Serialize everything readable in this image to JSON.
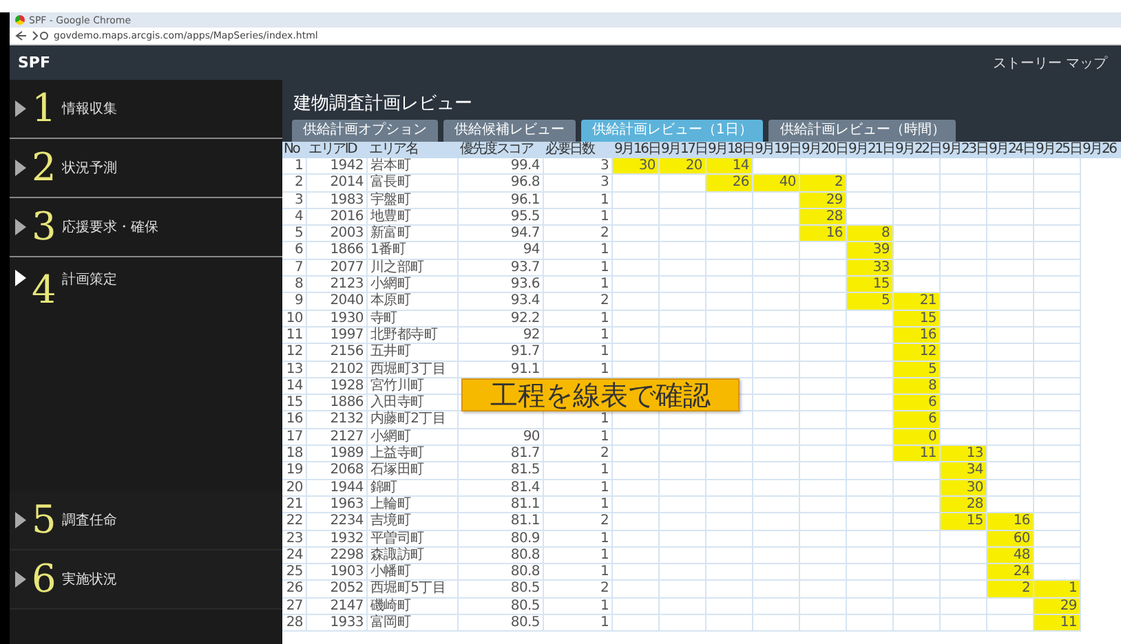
{
  "browser": {
    "title": "SPF - Google Chrome",
    "url": "govdemo.maps.arcgis.com/apps/MapSeries/index.html"
  },
  "header": {
    "app_name": "SPF",
    "link": "ストーリー マップ"
  },
  "sidebar": {
    "items": [
      {
        "number": "1",
        "label": "情報収集",
        "selected": false
      },
      {
        "number": "2",
        "label": "状況予測",
        "selected": false
      },
      {
        "number": "3",
        "label": "応援要求・確保",
        "selected": false
      },
      {
        "number": "4",
        "label": "計画策定",
        "selected": true
      },
      {
        "number": "5",
        "label": "調査任命",
        "selected": false
      },
      {
        "number": "6",
        "label": "実施状況",
        "selected": false
      }
    ]
  },
  "page_title": "建物調査計画レビュー",
  "tabs": [
    {
      "label": "供給計画オプション",
      "selected": false
    },
    {
      "label": "供給候補レビュー",
      "selected": false
    },
    {
      "label": "供給計画レビュー（1日）",
      "selected": true
    },
    {
      "label": "供給計画レビュー（時間）",
      "selected": false
    }
  ],
  "table": {
    "columns": [
      "No",
      "エリアID",
      "エリア名",
      "優先度スコア",
      "必要日数",
      "9月16日",
      "9月17日",
      "9月18日",
      "9月19日",
      "9月20日",
      "9月21日",
      "9月22日",
      "9月23日",
      "9月24日",
      "9月25日",
      "9月26"
    ],
    "rows": [
      {
        "cells": [
          "1",
          "1942",
          "岩本町",
          "99.4",
          "3",
          {
            "value": "30",
            "scheduled": true
          },
          {
            "value": "20",
            "scheduled": true
          },
          {
            "value": "14",
            "scheduled": true
          },
          {
            "scheduled": false
          },
          {
            "scheduled": false
          },
          {
            "scheduled": false
          },
          {
            "scheduled": false
          },
          {
            "scheduled": false
          },
          {
            "scheduled": false
          },
          {
            "scheduled": false
          }
        ]
      },
      {
        "cells": [
          "2",
          "2014",
          "富長町",
          "96.8",
          "3",
          {
            "scheduled": false
          },
          {
            "scheduled": false
          },
          {
            "value": "26",
            "scheduled": true
          },
          {
            "value": "40",
            "scheduled": true
          },
          {
            "value": "2",
            "scheduled": true
          },
          {
            "scheduled": false
          },
          {
            "scheduled": false
          },
          {
            "scheduled": false
          },
          {
            "scheduled": false
          },
          {
            "scheduled": false
          }
        ]
      },
      {
        "cells": [
          "3",
          "1983",
          "宇盤町",
          "96.1",
          "1",
          {
            "scheduled": false
          },
          {
            "scheduled": false
          },
          {
            "scheduled": false
          },
          {
            "scheduled": false
          },
          {
            "value": "29",
            "scheduled": true
          },
          {
            "scheduled": false
          },
          {
            "scheduled": false
          },
          {
            "scheduled": false
          },
          {
            "scheduled": false
          },
          {
            "scheduled": false
          }
        ]
      },
      {
        "cells": [
          "4",
          "2016",
          "地豊町",
          "95.5",
          "1",
          {
            "scheduled": false
          },
          {
            "scheduled": false
          },
          {
            "scheduled": false
          },
          {
            "scheduled": false
          },
          {
            "value": "28",
            "scheduled": true
          },
          {
            "scheduled": false
          },
          {
            "scheduled": false
          },
          {
            "scheduled": false
          },
          {
            "scheduled": false
          },
          {
            "scheduled": false
          }
        ]
      },
      {
        "cells": [
          "5",
          "2003",
          "新富町",
          "94.7",
          "2",
          {
            "scheduled": false
          },
          {
            "scheduled": false
          },
          {
            "scheduled": false
          },
          {
            "scheduled": false
          },
          {
            "value": "16",
            "scheduled": true
          },
          {
            "value": "8",
            "scheduled": true
          },
          {
            "scheduled": false
          },
          {
            "scheduled": false
          },
          {
            "scheduled": false
          },
          {
            "scheduled": false
          }
        ]
      },
      {
        "cells": [
          "6",
          "1866",
          "1番町",
          "94",
          "1",
          {
            "scheduled": false
          },
          {
            "scheduled": false
          },
          {
            "scheduled": false
          },
          {
            "scheduled": false
          },
          {
            "scheduled": false
          },
          {
            "value": "39",
            "scheduled": true
          },
          {
            "scheduled": false
          },
          {
            "scheduled": false
          },
          {
            "scheduled": false
          },
          {
            "scheduled": false
          }
        ]
      },
      {
        "cells": [
          "7",
          "2077",
          "川之部町",
          "93.7",
          "1",
          {
            "scheduled": false
          },
          {
            "scheduled": false
          },
          {
            "scheduled": false
          },
          {
            "scheduled": false
          },
          {
            "scheduled": false
          },
          {
            "value": "33",
            "scheduled": true
          },
          {
            "scheduled": false
          },
          {
            "scheduled": false
          },
          {
            "scheduled": false
          },
          {
            "scheduled": false
          }
        ]
      },
      {
        "cells": [
          "8",
          "2123",
          "小網町",
          "93.6",
          "1",
          {
            "scheduled": false
          },
          {
            "scheduled": false
          },
          {
            "scheduled": false
          },
          {
            "scheduled": false
          },
          {
            "scheduled": false
          },
          {
            "value": "15",
            "scheduled": true
          },
          {
            "scheduled": false
          },
          {
            "scheduled": false
          },
          {
            "scheduled": false
          },
          {
            "scheduled": false
          }
        ]
      },
      {
        "cells": [
          "9",
          "2040",
          "本原町",
          "93.4",
          "2",
          {
            "scheduled": false
          },
          {
            "scheduled": false
          },
          {
            "scheduled": false
          },
          {
            "scheduled": false
          },
          {
            "scheduled": false
          },
          {
            "value": "5",
            "scheduled": true
          },
          {
            "value": "21",
            "scheduled": true
          },
          {
            "scheduled": false
          },
          {
            "scheduled": false
          },
          {
            "scheduled": false
          }
        ]
      },
      {
        "cells": [
          "10",
          "1930",
          "寺町",
          "92.2",
          "1",
          {
            "scheduled": false
          },
          {
            "scheduled": false
          },
          {
            "scheduled": false
          },
          {
            "scheduled": false
          },
          {
            "scheduled": false
          },
          {
            "scheduled": false
          },
          {
            "value": "15",
            "scheduled": true
          },
          {
            "scheduled": false
          },
          {
            "scheduled": false
          },
          {
            "scheduled": false
          }
        ]
      },
      {
        "cells": [
          "11",
          "1997",
          "北野都寺町",
          "92",
          "1",
          {
            "scheduled": false
          },
          {
            "scheduled": false
          },
          {
            "scheduled": false
          },
          {
            "scheduled": false
          },
          {
            "scheduled": false
          },
          {
            "scheduled": false
          },
          {
            "value": "16",
            "scheduled": true
          },
          {
            "scheduled": false
          },
          {
            "scheduled": false
          },
          {
            "scheduled": false
          }
        ]
      },
      {
        "cells": [
          "12",
          "2156",
          "五井町",
          "91.7",
          "1",
          {
            "scheduled": false
          },
          {
            "scheduled": false
          },
          {
            "scheduled": false
          },
          {
            "scheduled": false
          },
          {
            "scheduled": false
          },
          {
            "scheduled": false
          },
          {
            "value": "12",
            "scheduled": true
          },
          {
            "scheduled": false
          },
          {
            "scheduled": false
          },
          {
            "scheduled": false
          }
        ]
      },
      {
        "cells": [
          "13",
          "2102",
          "西堀町3丁目",
          "91.1",
          "1",
          {
            "scheduled": false
          },
          {
            "scheduled": false
          },
          {
            "scheduled": false
          },
          {
            "scheduled": false
          },
          {
            "scheduled": false
          },
          {
            "scheduled": false
          },
          {
            "value": "5",
            "scheduled": true
          },
          {
            "scheduled": false
          },
          {
            "scheduled": false
          },
          {
            "scheduled": false
          }
        ]
      },
      {
        "cells": [
          "14",
          "1928",
          "宮竹川町",
          null,
          null,
          null,
          null,
          {
            "scheduled": false
          },
          {
            "scheduled": false
          },
          {
            "scheduled": false
          },
          {
            "scheduled": false
          },
          {
            "value": "8",
            "scheduled": true
          },
          {
            "scheduled": false
          },
          {
            "scheduled": false
          },
          {
            "scheduled": false
          }
        ]
      },
      {
        "cells": [
          "15",
          "1886",
          "入田寺町",
          null,
          null,
          null,
          null,
          {
            "scheduled": false
          },
          {
            "scheduled": false
          },
          {
            "scheduled": false
          },
          {
            "scheduled": false
          },
          {
            "value": "6",
            "scheduled": true
          },
          {
            "scheduled": false
          },
          {
            "scheduled": false
          },
          {
            "scheduled": false
          }
        ]
      },
      {
        "cells": [
          "16",
          "2132",
          "内藤町2丁目",
          "",
          "1",
          {
            "scheduled": false
          },
          {
            "scheduled": false
          },
          {
            "scheduled": false
          },
          {
            "scheduled": false
          },
          {
            "scheduled": false
          },
          {
            "scheduled": false
          },
          {
            "value": "6",
            "scheduled": true
          },
          {
            "scheduled": false
          },
          {
            "scheduled": false
          },
          {
            "scheduled": false
          }
        ]
      },
      {
        "cells": [
          "17",
          "2127",
          "小網町",
          "90",
          "1",
          {
            "scheduled": false
          },
          {
            "scheduled": false
          },
          {
            "scheduled": false
          },
          {
            "scheduled": false
          },
          {
            "scheduled": false
          },
          {
            "scheduled": false
          },
          {
            "value": "0",
            "scheduled": true
          },
          {
            "scheduled": false
          },
          {
            "scheduled": false
          },
          {
            "scheduled": false
          }
        ]
      },
      {
        "cells": [
          "18",
          "1989",
          "上益寺町",
          "81.7",
          "2",
          {
            "scheduled": false
          },
          {
            "scheduled": false
          },
          {
            "scheduled": false
          },
          {
            "scheduled": false
          },
          {
            "scheduled": false
          },
          {
            "scheduled": false
          },
          {
            "value": "11",
            "scheduled": true
          },
          {
            "value": "13",
            "scheduled": true
          },
          {
            "scheduled": false
          },
          {
            "scheduled": false
          }
        ]
      },
      {
        "cells": [
          "19",
          "2068",
          "石塚田町",
          "81.5",
          "1",
          {
            "scheduled": false
          },
          {
            "scheduled": false
          },
          {
            "scheduled": false
          },
          {
            "scheduled": false
          },
          {
            "scheduled": false
          },
          {
            "scheduled": false
          },
          {
            "scheduled": false
          },
          {
            "value": "34",
            "scheduled": true
          },
          {
            "scheduled": false
          },
          {
            "scheduled": false
          }
        ]
      },
      {
        "cells": [
          "20",
          "1944",
          "錦町",
          "81.4",
          "1",
          {
            "scheduled": false
          },
          {
            "scheduled": false
          },
          {
            "scheduled": false
          },
          {
            "scheduled": false
          },
          {
            "scheduled": false
          },
          {
            "scheduled": false
          },
          {
            "scheduled": false
          },
          {
            "value": "30",
            "scheduled": true
          },
          {
            "scheduled": false
          },
          {
            "scheduled": false
          }
        ]
      },
      {
        "cells": [
          "21",
          "1963",
          "上輪町",
          "81.1",
          "1",
          {
            "scheduled": false
          },
          {
            "scheduled": false
          },
          {
            "scheduled": false
          },
          {
            "scheduled": false
          },
          {
            "scheduled": false
          },
          {
            "scheduled": false
          },
          {
            "scheduled": false
          },
          {
            "value": "28",
            "scheduled": true
          },
          {
            "scheduled": false
          },
          {
            "scheduled": false
          }
        ]
      },
      {
        "cells": [
          "22",
          "2234",
          "吉境町",
          "81.1",
          "2",
          {
            "scheduled": false
          },
          {
            "scheduled": false
          },
          {
            "scheduled": false
          },
          {
            "scheduled": false
          },
          {
            "scheduled": false
          },
          {
            "scheduled": false
          },
          {
            "scheduled": false
          },
          {
            "value": "15",
            "scheduled": true
          },
          {
            "value": "16",
            "scheduled": true
          },
          {
            "scheduled": false
          }
        ]
      },
      {
        "cells": [
          "23",
          "1932",
          "平曽司町",
          "80.9",
          "1",
          {
            "scheduled": false
          },
          {
            "scheduled": false
          },
          {
            "scheduled": false
          },
          {
            "scheduled": false
          },
          {
            "scheduled": false
          },
          {
            "scheduled": false
          },
          {
            "scheduled": false
          },
          {
            "scheduled": false
          },
          {
            "value": "60",
            "scheduled": true
          },
          {
            "scheduled": false
          }
        ]
      },
      {
        "cells": [
          "24",
          "2298",
          "森諏訪町",
          "80.8",
          "1",
          {
            "scheduled": false
          },
          {
            "scheduled": false
          },
          {
            "scheduled": false
          },
          {
            "scheduled": false
          },
          {
            "scheduled": false
          },
          {
            "scheduled": false
          },
          {
            "scheduled": false
          },
          {
            "scheduled": false
          },
          {
            "value": "48",
            "scheduled": true
          },
          {
            "scheduled": false
          }
        ]
      },
      {
        "cells": [
          "25",
          "1903",
          "小幡町",
          "80.8",
          "1",
          {
            "scheduled": false
          },
          {
            "scheduled": false
          },
          {
            "scheduled": false
          },
          {
            "scheduled": false
          },
          {
            "scheduled": false
          },
          {
            "scheduled": false
          },
          {
            "scheduled": false
          },
          {
            "scheduled": false
          },
          {
            "value": "24",
            "scheduled": true
          },
          {
            "scheduled": false
          }
        ]
      },
      {
        "cells": [
          "26",
          "2052",
          "西堀町5丁目",
          "80.5",
          "2",
          {
            "scheduled": false
          },
          {
            "scheduled": false
          },
          {
            "scheduled": false
          },
          {
            "scheduled": false
          },
          {
            "scheduled": false
          },
          {
            "scheduled": false
          },
          {
            "scheduled": false
          },
          {
            "scheduled": false
          },
          {
            "value": "2",
            "scheduled": true
          },
          {
            "value": "1",
            "scheduled": true
          }
        ]
      },
      {
        "cells": [
          "27",
          "2147",
          "磯崎町",
          "80.5",
          "1",
          {
            "scheduled": false
          },
          {
            "scheduled": false
          },
          {
            "scheduled": false
          },
          {
            "scheduled": false
          },
          {
            "scheduled": false
          },
          {
            "scheduled": false
          },
          {
            "scheduled": false
          },
          {
            "scheduled": false
          },
          {
            "scheduled": false
          },
          {
            "value": "29",
            "scheduled": true
          }
        ]
      },
      {
        "cells": [
          "28",
          "1933",
          "富岡町",
          "80.5",
          "1",
          {
            "scheduled": false
          },
          {
            "scheduled": false
          },
          {
            "scheduled": false
          },
          {
            "scheduled": false
          },
          {
            "scheduled": false
          },
          {
            "scheduled": false
          },
          {
            "scheduled": false
          },
          {
            "scheduled": false
          },
          {
            "scheduled": false
          },
          {
            "value": "11",
            "scheduled": true
          }
        ]
      }
    ]
  },
  "callout": {
    "text": "工程を線表で確認"
  }
}
